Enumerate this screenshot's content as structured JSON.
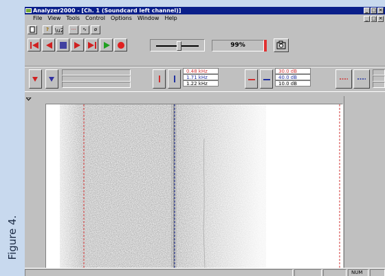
{
  "figure_label": "Figure 4.",
  "app": {
    "title": "Analyzer2000 - [Ch. 1 (Soundcard left channel)]",
    "window_buttons": [
      "_",
      "□",
      "✕"
    ],
    "mdi_buttons": [
      "_",
      "□",
      "✕"
    ],
    "menu": [
      "File",
      "View",
      "Tools",
      "Control",
      "Options",
      "Window",
      "Help"
    ]
  },
  "toolbar": {
    "buttons": [
      {
        "name": "new-icon",
        "glyph": "🗋"
      },
      {
        "name": "help-icon",
        "glyph": "?"
      },
      {
        "name": "context-help-icon",
        "glyph": "⁈"
      },
      {
        "name": "dots-icon",
        "glyph": "···"
      },
      {
        "name": "wave-icon",
        "glyph": "∿"
      },
      {
        "name": "phi-icon",
        "glyph": "ø"
      }
    ]
  },
  "transport": {
    "percent": "99%"
  },
  "frequency": {
    "values": [
      "0.48 kHz",
      "1.71 kHz",
      "1.22 kHz"
    ],
    "colors": [
      "#d03030",
      "#2030a0",
      "#000000"
    ]
  },
  "level": {
    "values": [
      "30.0 dB",
      "40.0 dB",
      "10.0 dB"
    ],
    "colors": [
      "#d03030",
      "#2030a0",
      "#000000"
    ]
  },
  "status": {
    "num": "NUM"
  },
  "colors": {
    "accent": "#0a1f8a",
    "marker_red": "#d03030",
    "marker_blue": "#2030a0"
  }
}
